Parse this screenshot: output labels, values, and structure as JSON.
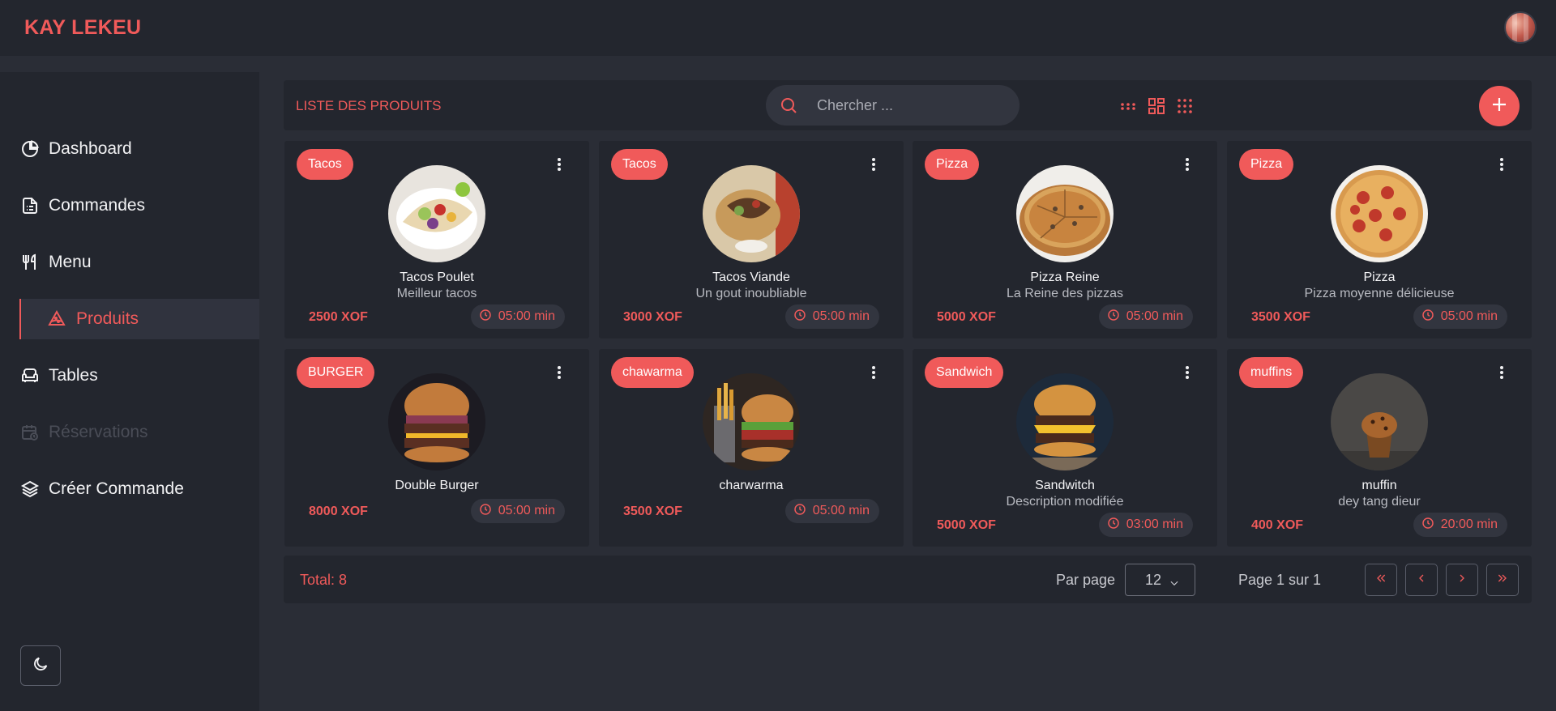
{
  "app": {
    "brand": "KAY LEKEU"
  },
  "sidebar": {
    "items": [
      {
        "label": "Dashboard",
        "icon": "pie-chart-icon"
      },
      {
        "label": "Commandes",
        "icon": "document-list-icon"
      },
      {
        "label": "Menu",
        "icon": "utensils-icon"
      },
      {
        "label": "Produits",
        "icon": "pizza-slice-icon",
        "active": true
      },
      {
        "label": "Tables",
        "icon": "sofa-icon"
      },
      {
        "label": "Réservations",
        "icon": "calendar-clock-icon",
        "disabled": true
      },
      {
        "label": "Créer Commande",
        "icon": "layers-icon"
      }
    ],
    "theme_toggle_icon": "moon-icon"
  },
  "toolbar": {
    "title": "LISTE DES PRODUITS",
    "search_placeholder": "Chercher ...",
    "view_icons": [
      "dots-small-grid-icon",
      "large-grid-icon",
      "dots-grid-icon"
    ],
    "add_icon": "plus-icon"
  },
  "products": [
    {
      "category": "Tacos",
      "name": "Tacos Poulet",
      "description": "Meilleur tacos",
      "price": "2500 XOF",
      "time": "05:00 min",
      "photo": "tacos-poulet"
    },
    {
      "category": "Tacos",
      "name": "Tacos Viande",
      "description": "Un gout inoubliable",
      "price": "3000 XOF",
      "time": "05:00 min",
      "photo": "tacos-viande"
    },
    {
      "category": "Pizza",
      "name": "Pizza Reine",
      "description": "La Reine des pizzas",
      "price": "5000 XOF",
      "time": "05:00 min",
      "photo": "pizza-reine"
    },
    {
      "category": "Pizza",
      "name": "Pizza",
      "description": "Pizza moyenne délicieuse",
      "price": "3500 XOF",
      "time": "05:00 min",
      "photo": "pizza-pepperoni"
    },
    {
      "category": "BURGER",
      "name": "Double Burger",
      "description": "",
      "price": "8000 XOF",
      "time": "05:00 min",
      "photo": "double-burger"
    },
    {
      "category": "chawarma",
      "name": "charwarma",
      "description": "",
      "price": "3500 XOF",
      "time": "05:00 min",
      "photo": "burger-fries"
    },
    {
      "category": "Sandwich",
      "name": "Sandwitch",
      "description": "Description modifiée",
      "price": "5000 XOF",
      "time": "03:00 min",
      "photo": "cheeseburger"
    },
    {
      "category": "muffins",
      "name": "muffin",
      "description": "dey tang dieur",
      "price": "400 XOF",
      "time": "20:00 min",
      "photo": "muffin"
    }
  ],
  "footer": {
    "total": "Total: 8",
    "per_page_label": "Par page",
    "per_page_value": "12",
    "page_info": "Page 1 sur 1",
    "pager_icons": [
      "double-chevron-left-icon",
      "chevron-left-icon",
      "chevron-right-icon",
      "double-chevron-right-icon"
    ]
  },
  "colors": {
    "accent": "#f05a5a",
    "background": "#2a2d36",
    "panel": "#23262e"
  }
}
